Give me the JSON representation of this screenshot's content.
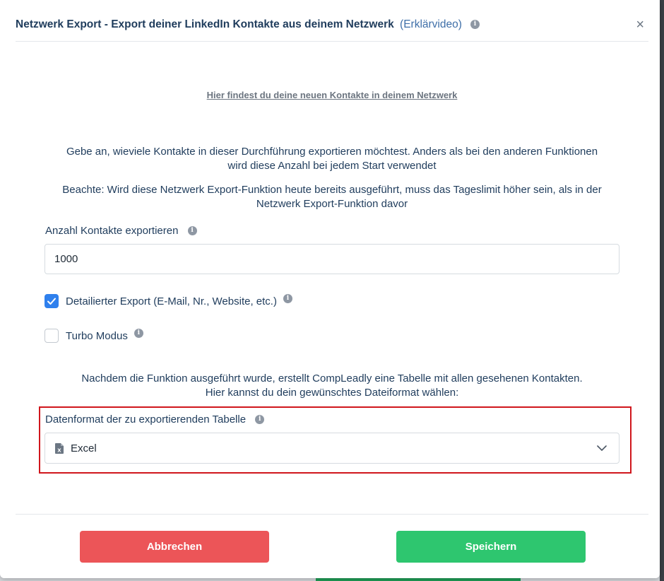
{
  "dialog": {
    "title": "Netzwerk Export - Export deiner LinkedIn Kontakte aus deinem Netzwerk",
    "title_link": "(Erklärvideo)",
    "info_icon": "info-icon",
    "close_label": "×"
  },
  "network_link": "Hier findest du deine neuen Kontakte in deinem Netzwerk",
  "intro": {
    "line1": "Gebe an, wieviele Kontakte in dieser Durchführung exportieren möchtest. Anders als bei den anderen Funktionen",
    "line2": "wird diese Anzahl bei jedem Start verwendet",
    "note_line1": "Beachte: Wird diese Netzwerk Export-Funktion heute bereits ausgeführt, muss das Tageslimit höher sein, als in der",
    "note_line2": "Netzwerk Export-Funktion davor"
  },
  "contacts_field": {
    "label": "Anzahl Kontakte exportieren",
    "value": "1000"
  },
  "options": [
    {
      "label": "Detailierter Export (E-Mail, Nr., Website, etc.)",
      "checked": true
    },
    {
      "label": "Turbo Modus",
      "checked": false
    }
  ],
  "export_info": {
    "line1": "Nachdem die Funktion ausgeführt wurde, erstellt CompLeadly eine Tabelle mit allen gesehenen Kontakten.",
    "line2": "Hier kannst du dein gewünschtes Dateiformat wählen:"
  },
  "format_field": {
    "label": "Datenformat der zu exportierenden Tabelle",
    "selected": "Excel",
    "icon": "excel-file-icon"
  },
  "buttons": {
    "cancel": "Abbrechen",
    "save": "Speichern"
  },
  "colors": {
    "title": "#1f3c5c",
    "link": "#3f6fa8",
    "checkbox_checked": "#2f80ed",
    "cancel": "#ec5558",
    "save": "#2ec66f",
    "highlight": "#d0161c"
  }
}
